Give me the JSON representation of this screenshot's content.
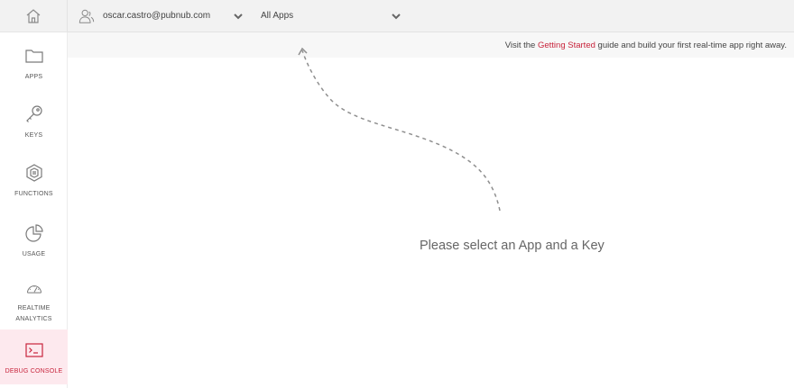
{
  "sidebar": {
    "items": [
      {
        "id": "apps",
        "label": "APPS"
      },
      {
        "id": "keys",
        "label": "KEYS"
      },
      {
        "id": "functions",
        "label": "FUNCTIONS"
      },
      {
        "id": "usage",
        "label": "USAGE"
      },
      {
        "id": "realtime",
        "label": "REALTIME ANALYTICS"
      },
      {
        "id": "debug",
        "label": "DEBUG CONSOLE",
        "active": true
      }
    ]
  },
  "topbar": {
    "user_email": "oscar.castro@pubnub.com",
    "app_select": "All Apps"
  },
  "banner": {
    "prefix": "Visit the",
    "link": "Getting Started",
    "suffix": "guide and build your first real-time app right away."
  },
  "main": {
    "message": "Please select an App and a Key"
  },
  "colors": {
    "accent": "#c8243c",
    "active_bg": "#fde9ee",
    "topbar_bg": "#f2f2f2"
  },
  "icons": [
    "home-icon",
    "folder-icon",
    "key-icon",
    "functions-icon",
    "pie-chart-icon",
    "gauge-icon",
    "terminal-icon",
    "user-icon",
    "chevron-down-icon"
  ]
}
